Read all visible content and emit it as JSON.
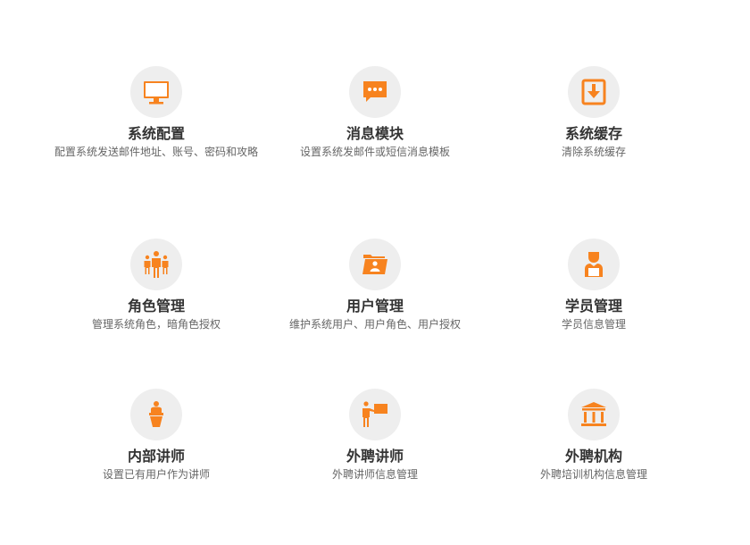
{
  "accent_color": "#f7831f",
  "tiles": [
    {
      "title": "系统配置",
      "desc": "配置系统发送邮件地址、账号、密码和攻略",
      "icon": "monitor-icon"
    },
    {
      "title": "消息模块",
      "desc": "设置系统发邮件或短信消息模板",
      "icon": "chat-bubble-icon"
    },
    {
      "title": "系统缓存",
      "desc": "清除系统缓存",
      "icon": "download-box-icon"
    },
    {
      "title": "角色管理",
      "desc": "管理系统角色，暗角色授权",
      "icon": "people-group-icon"
    },
    {
      "title": "用户管理",
      "desc": "维护系统用户、用户角色、用户授权",
      "icon": "user-folder-icon"
    },
    {
      "title": "学员管理",
      "desc": "学员信息管理",
      "icon": "student-icon"
    },
    {
      "title": "内部讲师",
      "desc": "设置已有用户作为讲师",
      "icon": "podium-speaker-icon"
    },
    {
      "title": "外聘讲师",
      "desc": "外聘讲师信息管理",
      "icon": "presenter-board-icon"
    },
    {
      "title": "外聘机构",
      "desc": "外聘培训机构信息管理",
      "icon": "institution-building-icon"
    }
  ]
}
